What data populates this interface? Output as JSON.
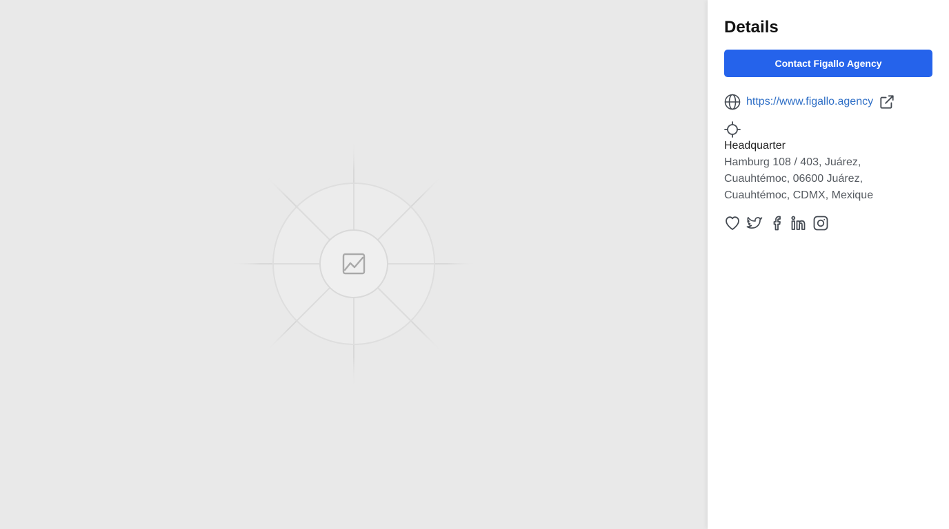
{
  "details": {
    "title": "Details",
    "contact_button_label": "Contact Figallo Agency",
    "website_url": "https://www.figallo.agency",
    "headquarter_label": "Headquarter",
    "headquarter_address": "Hamburg 108 / 403, Juárez, Cuauhtémoc, 06600 Juárez, Cuauhtémoc, CDMX, Mexique"
  },
  "icons": {
    "globe": "globe-icon",
    "external_link": "external-link-icon",
    "location": "crosshair-icon",
    "social": [
      "heart-icon",
      "twitter-icon",
      "facebook-icon",
      "linkedin-icon",
      "instagram-icon"
    ],
    "placeholder": "image-placeholder-icon"
  },
  "colors": {
    "primary_button": "#2563eb",
    "link": "#2f6fc6",
    "media_background": "#e9e9e9"
  }
}
